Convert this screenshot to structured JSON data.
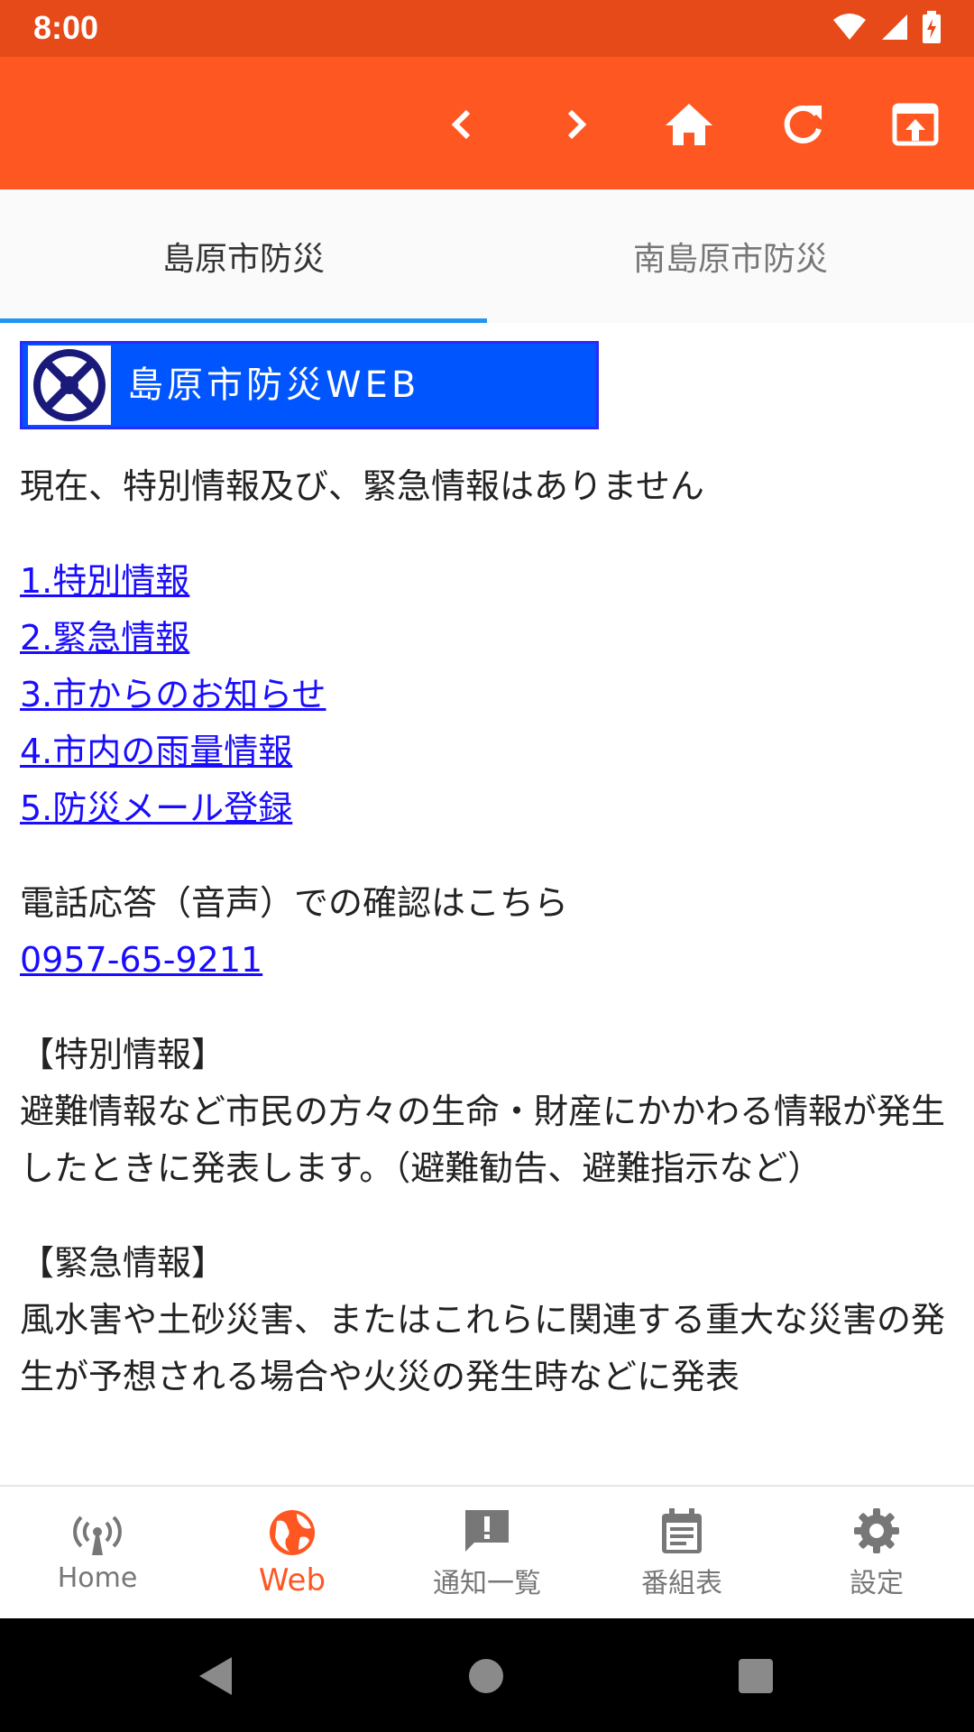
{
  "status": {
    "time": "8:00"
  },
  "tabs": [
    {
      "label": "島原市防災"
    },
    {
      "label": "南島原市防災"
    }
  ],
  "banner": {
    "text": "島原市防災WEB"
  },
  "content": {
    "notice": "現在、特別情報及び、緊急情報はありません",
    "links": [
      "1.特別情報",
      "2.緊急情報",
      "3.市からのお知らせ",
      "4.市内の雨量情報",
      "5.防災メール登録"
    ],
    "phone_label": "電話応答（音声）での確認はこちら",
    "phone_number": "0957-65-9211",
    "special_title": "【特別情報】",
    "special_body": "避難情報など市民の方々の生命・財産にかかわる情報が発生したときに発表します。（避難勧告、避難指示など）",
    "emergency_title": "【緊急情報】",
    "emergency_body": "風水害や土砂災害、またはこれらに関連する重大な災害の発生が予想される場合や火災の発生時などに発表"
  },
  "bottom_nav": [
    {
      "label": "Home",
      "icon": "broadcast-icon"
    },
    {
      "label": "Web",
      "icon": "globe-icon"
    },
    {
      "label": "通知一覧",
      "icon": "alert-icon"
    },
    {
      "label": "番組表",
      "icon": "schedule-icon"
    },
    {
      "label": "設定",
      "icon": "gear-icon"
    }
  ],
  "colors": {
    "status_bar": "#E64A19",
    "toolbar": "#FF5722",
    "accent": "#FF5722",
    "tab_indicator": "#2196F3",
    "link": "#1a0dff",
    "banner": "#0055FF"
  }
}
